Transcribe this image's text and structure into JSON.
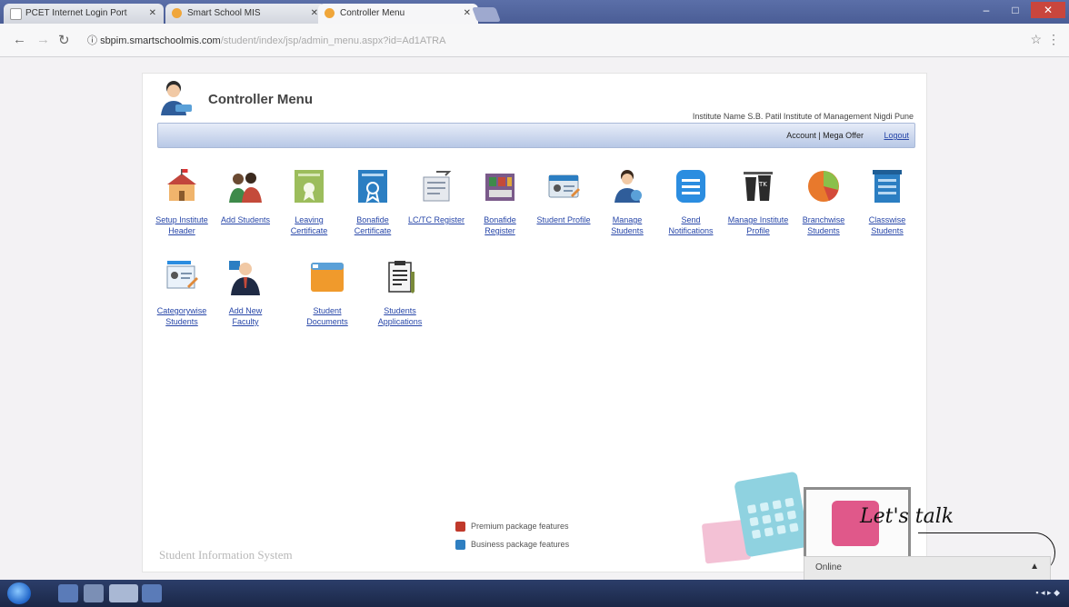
{
  "browser": {
    "tabs": [
      {
        "title": "PCET Internet Login Port"
      },
      {
        "title": "Smart School MIS"
      },
      {
        "title": "Controller Menu"
      }
    ],
    "url_host": "sbpim.smartschoolmis.com",
    "url_path": "/student/index/jsp/admin_menu.aspx?id=Ad1ATRA"
  },
  "page": {
    "title": "Controller Menu",
    "institute": "Institute Name  S.B. Patil Institute of Management Nigdi Pune",
    "account": "Account",
    "mega_offer": "Mega Offer",
    "logout": "Logout",
    "menu_items": [
      {
        "label": "Setup Institute Header",
        "icon": "school-building-icon"
      },
      {
        "label": "Add Students",
        "icon": "students-group-icon"
      },
      {
        "label": "Leaving Certificate",
        "icon": "leaving-certificate-icon"
      },
      {
        "label": "Bonafide Certificate",
        "icon": "bonafide-certificate-icon"
      },
      {
        "label": "LC/TC Register",
        "icon": "register-icon"
      },
      {
        "label": "Bonafide Register",
        "icon": "bonafide-register-icon"
      },
      {
        "label": "Student Profile",
        "icon": "student-profile-icon"
      },
      {
        "label": "Manage Students",
        "icon": "manage-students-icon"
      },
      {
        "label": "Send Notifications",
        "icon": "notification-icon"
      },
      {
        "label": "Manage Institute Profile",
        "icon": "institute-profile-icon"
      },
      {
        "label": "Branchwise Students",
        "icon": "pie-chart-icon"
      },
      {
        "label": "Classwise Students",
        "icon": "class-list-icon"
      },
      {
        "label": "Categorywise Students",
        "icon": "category-card-icon"
      },
      {
        "label": "Add New Faculty",
        "icon": "faculty-icon"
      },
      {
        "label": "Student Documents",
        "icon": "folder-icon"
      },
      {
        "label": "Students Applications",
        "icon": "application-form-icon"
      }
    ],
    "legend": {
      "premium": "Premium package features",
      "business": "Business package features",
      "premium_color": "#c0392b",
      "business_color": "#2f7fc1"
    },
    "footer": "Student Information System"
  },
  "chat": {
    "heading": "Let's talk",
    "status": "Online"
  },
  "colors": {
    "link": "#2746a8",
    "bar": "#b8c8e6",
    "chat_pink": "#e0588a"
  }
}
